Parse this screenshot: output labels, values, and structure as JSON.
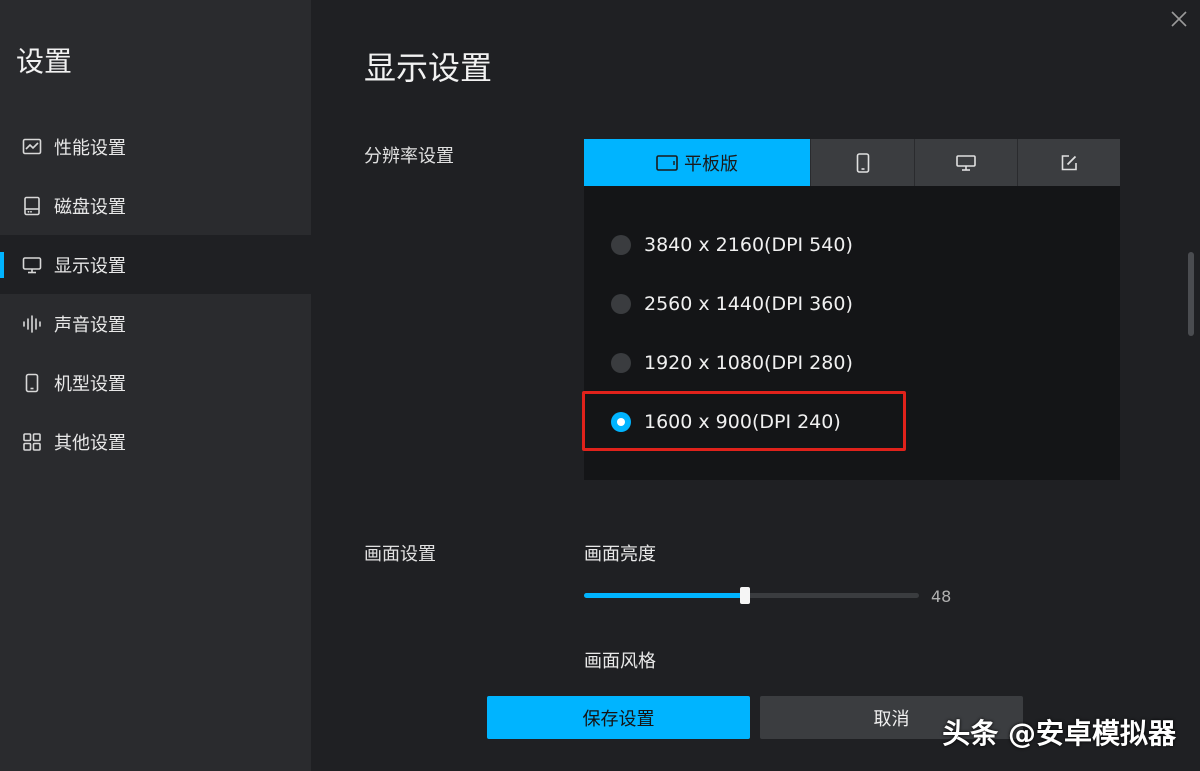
{
  "sidebar": {
    "title": "设置",
    "items": [
      {
        "label": "性能设置",
        "icon": "chart-icon"
      },
      {
        "label": "磁盘设置",
        "icon": "disk-icon"
      },
      {
        "label": "显示设置",
        "icon": "monitor-icon",
        "active": true
      },
      {
        "label": "声音设置",
        "icon": "sound-icon"
      },
      {
        "label": "机型设置",
        "icon": "phone-icon"
      },
      {
        "label": "其他设置",
        "icon": "grid-icon"
      }
    ]
  },
  "main": {
    "title": "显示设置",
    "resolution": {
      "label": "分辨率设置",
      "tabs": [
        {
          "label": "平板版",
          "icon": "tablet-icon",
          "active": true
        },
        {
          "label": "",
          "icon": "phone-icon"
        },
        {
          "label": "",
          "icon": "monitor-icon"
        },
        {
          "label": "",
          "icon": "edit-icon"
        }
      ],
      "options": [
        {
          "label": "3840 x 2160(DPI 540)",
          "checked": false
        },
        {
          "label": "2560 x 1440(DPI 360)",
          "checked": false
        },
        {
          "label": "1920 x 1080(DPI 280)",
          "checked": false
        },
        {
          "label": "1600 x 900(DPI 240)",
          "checked": true
        }
      ]
    },
    "display": {
      "label": "画面设置",
      "brightness_label": "画面亮度",
      "brightness_value": "48",
      "style_label": "画面风格"
    },
    "buttons": {
      "save": "保存设置",
      "cancel": "取消"
    }
  },
  "watermark": "头条 @安卓模拟器",
  "colors": {
    "accent": "#00b4ff",
    "highlight": "#e0221b",
    "sidebar_bg": "#2a2b2e",
    "main_bg": "#1f2023"
  }
}
